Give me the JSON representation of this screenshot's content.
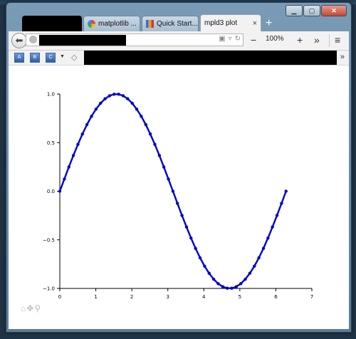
{
  "browser": {
    "tabs": [
      {
        "label": "",
        "redacted": true,
        "icon": ""
      },
      {
        "label": "matplotlib ...",
        "icon": "google-icon"
      },
      {
        "label": "Quick Start...",
        "icon": "bars-icon"
      },
      {
        "label": "mpld3 plot",
        "icon": "",
        "active": true
      }
    ],
    "new_tab_label": "+",
    "close_tab_label": "×",
    "zoom": "100%",
    "zoom_out_label": "−",
    "zoom_in_label": "+",
    "overflow_label": "»",
    "menu_label": "≡",
    "bookmarks": [
      "bookmark-icon-1",
      "bookmark-icon-2",
      "bookmark-icon-3"
    ]
  },
  "colors": {
    "line": "#0000cc",
    "axis": "#000000"
  },
  "chart_data": {
    "type": "line",
    "title": "",
    "xlabel": "",
    "ylabel": "",
    "xlim": [
      0,
      7
    ],
    "ylim": [
      -1.0,
      1.0
    ],
    "xticks": [
      "0",
      "1",
      "2",
      "3",
      "4",
      "5",
      "6",
      "7"
    ],
    "yticks": [
      "1.0",
      "0.5",
      "0.0",
      "−0.5",
      "−1.0"
    ],
    "ytick_values": [
      1.0,
      0.5,
      0.0,
      -0.5,
      -1.0
    ],
    "grid": false,
    "series": [
      {
        "markers": true,
        "x": [
          0,
          0.126,
          0.251,
          0.377,
          0.503,
          0.628,
          0.754,
          0.88,
          1.005,
          1.131,
          1.257,
          1.382,
          1.508,
          1.634,
          1.759,
          1.885,
          2.011,
          2.136,
          2.262,
          2.388,
          2.513,
          2.639,
          2.765,
          2.89,
          3.016,
          3.142,
          3.267,
          3.393,
          3.519,
          3.644,
          3.77,
          3.896,
          4.021,
          4.147,
          4.273,
          4.398,
          4.524,
          4.65,
          4.775,
          4.901,
          5.027,
          5.152,
          5.278,
          5.404,
          5.529,
          5.655,
          5.781,
          5.906,
          6.032,
          6.158,
          6.283
        ],
        "y": [
          0.0,
          0.125,
          0.249,
          0.368,
          0.482,
          0.588,
          0.685,
          0.771,
          0.844,
          0.905,
          0.951,
          0.982,
          0.998,
          0.998,
          0.982,
          0.951,
          0.905,
          0.844,
          0.771,
          0.685,
          0.588,
          0.482,
          0.368,
          0.249,
          0.125,
          0.0,
          -0.125,
          -0.249,
          -0.368,
          -0.482,
          -0.588,
          -0.685,
          -0.771,
          -0.844,
          -0.905,
          -0.951,
          -0.982,
          -0.998,
          -0.998,
          -0.982,
          -0.951,
          -0.905,
          -0.844,
          -0.771,
          -0.685,
          -0.588,
          -0.482,
          -0.368,
          -0.249,
          -0.125,
          0.0
        ]
      }
    ]
  },
  "mpld3_toolbar": {
    "home": "⌂",
    "pan": "✥",
    "zoom": "⚲"
  }
}
